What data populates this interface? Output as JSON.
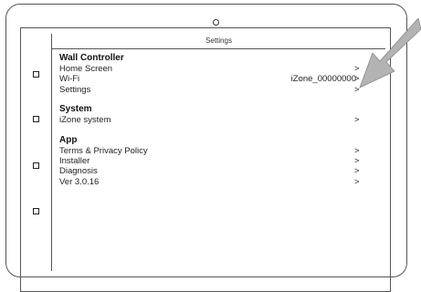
{
  "header": {
    "title": "Settings"
  },
  "sections": [
    {
      "title": "Wall Controller",
      "items": [
        {
          "label": "Home Screen",
          "value": "",
          "chevron": ">"
        },
        {
          "label": "Wi-Fi",
          "value": "iZone_00000000",
          "chevron": ">"
        },
        {
          "label": "Settings",
          "value": "",
          "chevron": ">"
        }
      ]
    },
    {
      "title": "System",
      "items": [
        {
          "label": "iZone system",
          "value": "",
          "chevron": ">"
        }
      ]
    },
    {
      "title": "App",
      "items": [
        {
          "label": "Terms & Privacy Policy",
          "value": "",
          "chevron": ">"
        },
        {
          "label": "Installer",
          "value": "",
          "chevron": ">"
        },
        {
          "label": "Diagnosis",
          "value": "",
          "chevron": ">"
        },
        {
          "label": "Ver 3.0.16",
          "value": "",
          "chevron": ">"
        }
      ]
    }
  ],
  "colors": {
    "line": "#555555",
    "arrow_fill": "#b3b3b3"
  }
}
